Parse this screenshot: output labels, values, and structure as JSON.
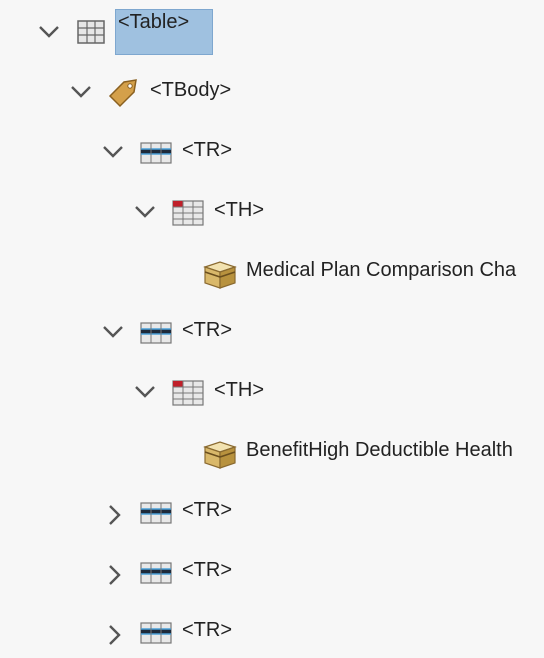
{
  "tree": {
    "nodes": [
      {
        "label": "<Table>",
        "icon": "table-icon",
        "state": "expanded",
        "selected": true
      },
      {
        "label": "<TBody>",
        "icon": "tag-icon",
        "state": "expanded"
      },
      {
        "label": "<TR>",
        "icon": "table-row-icon",
        "state": "expanded"
      },
      {
        "label": "<TH>",
        "icon": "table-header-icon",
        "state": "expanded"
      },
      {
        "label": "Medical Plan Comparison Cha",
        "icon": "content-box-icon",
        "state": "leaf"
      },
      {
        "label": "<TR>",
        "icon": "table-row-icon",
        "state": "expanded"
      },
      {
        "label": "<TH>",
        "icon": "table-header-icon",
        "state": "expanded"
      },
      {
        "label": "BenefitHigh Deductible Health",
        "icon": "content-box-icon",
        "state": "leaf"
      },
      {
        "label": "<TR>",
        "icon": "table-row-icon",
        "state": "collapsed"
      },
      {
        "label": "<TR>",
        "icon": "table-row-icon",
        "state": "collapsed"
      },
      {
        "label": "<TR>",
        "icon": "table-row-icon",
        "state": "collapsed"
      }
    ]
  },
  "colors": {
    "selection": "#9fc1e0",
    "selection_border": "#7ea7cf",
    "background": "#f7f7f7",
    "chevron": "#555555"
  }
}
